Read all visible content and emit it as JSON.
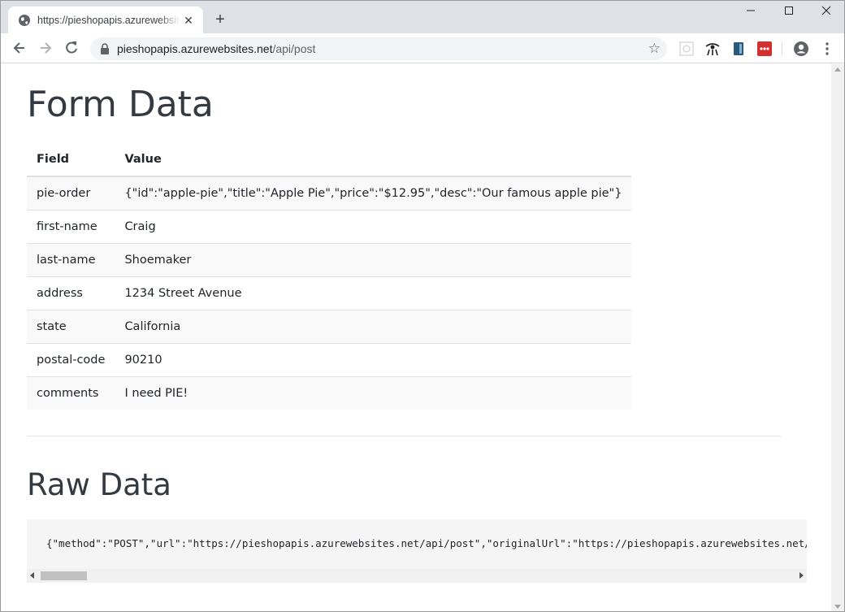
{
  "browser": {
    "tab_title": "https://pieshopapis.azurewebsites.net/api/post",
    "url_host": "pieshopapis.azurewebsites.net",
    "url_path": "/api/post",
    "new_tab_icon": "plus-icon",
    "window_controls": [
      "minimize",
      "maximize",
      "close"
    ],
    "extensions": [
      "extension-grid-icon",
      "extension-eye-icon",
      "extension-book-icon",
      "extension-red-icon"
    ]
  },
  "page": {
    "form_heading": "Form Data",
    "table": {
      "headers": [
        "Field",
        "Value"
      ],
      "rows": [
        {
          "field": "pie-order",
          "value": "{\"id\":\"apple-pie\",\"title\":\"Apple Pie\",\"price\":\"$12.95\",\"desc\":\"Our famous apple pie\"}"
        },
        {
          "field": "first-name",
          "value": "Craig"
        },
        {
          "field": "last-name",
          "value": "Shoemaker"
        },
        {
          "field": "address",
          "value": "1234 Street Avenue"
        },
        {
          "field": "state",
          "value": "California"
        },
        {
          "field": "postal-code",
          "value": "90210"
        },
        {
          "field": "comments",
          "value": "I need PIE!"
        }
      ]
    },
    "raw_heading": "Raw Data",
    "raw_text": "{\"method\":\"POST\",\"url\":\"https://pieshopapis.azurewebsites.net/api/post\",\"originalUrl\":\"https://pieshopapis.azurewebsites.net/api/post\"}"
  },
  "colors": {
    "tabstrip": "#dee1e6",
    "heading": "#343a40",
    "table_stripe": "#f9f9f9",
    "code_bg": "#f5f5f5"
  }
}
